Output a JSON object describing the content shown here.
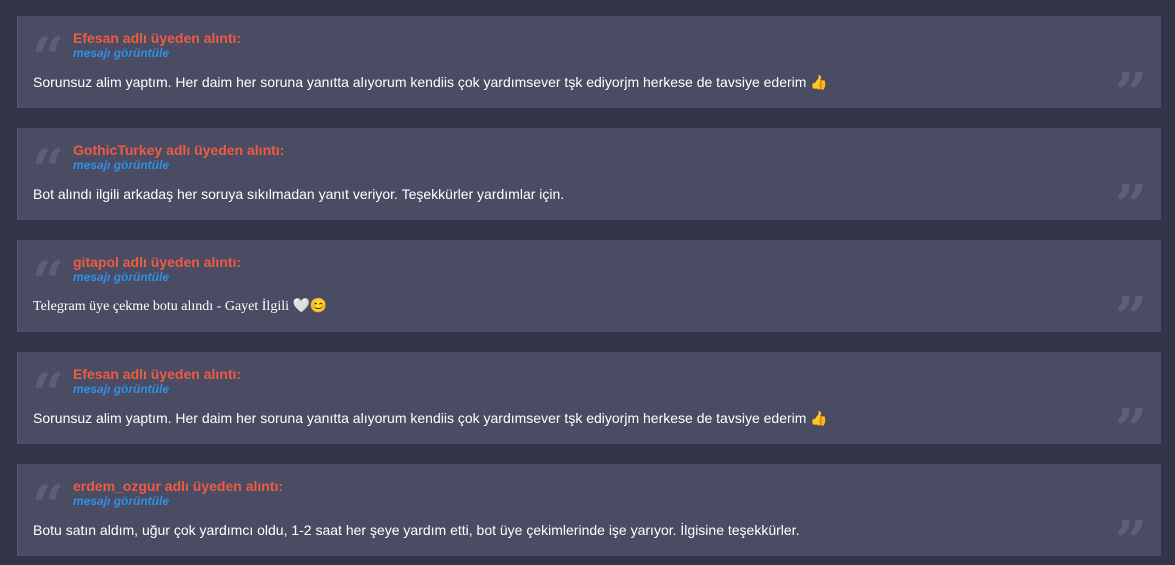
{
  "quotes": [
    {
      "author": "Efesan adlı üyeden alıntı:",
      "link": "mesajı görüntüle",
      "text": "Sorunsuz alim yaptım. Her daim her soruna yanıtta alıyorum kendiis çok yardımsever tşk ediyorjm herkese de tavsiye ederim 👍",
      "open_icon": "quote-open-icon",
      "close_icon": "quote-close-icon"
    },
    {
      "author": "GothicTurkey adlı üyeden alıntı:",
      "link": "mesajı görüntüle",
      "text": "Bot alındı ilgili arkadaş her soruya sıkılmadan yanıt veriyor. Teşekkürler yardımlar için.",
      "open_icon": "quote-open-icon",
      "close_icon": "quote-close-icon"
    },
    {
      "author": "gitapol adlı üyeden alıntı:",
      "link": "mesajı görüntüle",
      "text": "Telegram üye çekme botu alındı - Gayet İlgili 🤍😊",
      "open_icon": "quote-open-icon",
      "close_icon": "quote-close-icon"
    },
    {
      "author": "Efesan adlı üyeden alıntı:",
      "link": "mesajı görüntüle",
      "text": "Sorunsuz alim yaptım. Her daim her soruna yanıtta alıyorum kendiis çok yardımsever tşk ediyorjm herkese de tavsiye ederim 👍",
      "open_icon": "quote-open-icon",
      "close_icon": "quote-close-icon"
    },
    {
      "author": "erdem_ozgur adlı üyeden alıntı:",
      "link": "mesajı görüntüle",
      "text": "Botu satın aldım, uğur çok yardımcı oldu, 1-2 saat her şeye yardım etti, bot üye çekimlerinde işe yarıyor. İlgisine teşekkürler.",
      "open_icon": "quote-open-icon",
      "close_icon": "quote-close-icon"
    }
  ],
  "colors": {
    "page_background": "#33364a",
    "quote_background": "#4a4c64",
    "author": "#ef5b41",
    "link": "#2f8fe0",
    "text": "#ffffff",
    "quote_mark": "#5c5f7b"
  }
}
